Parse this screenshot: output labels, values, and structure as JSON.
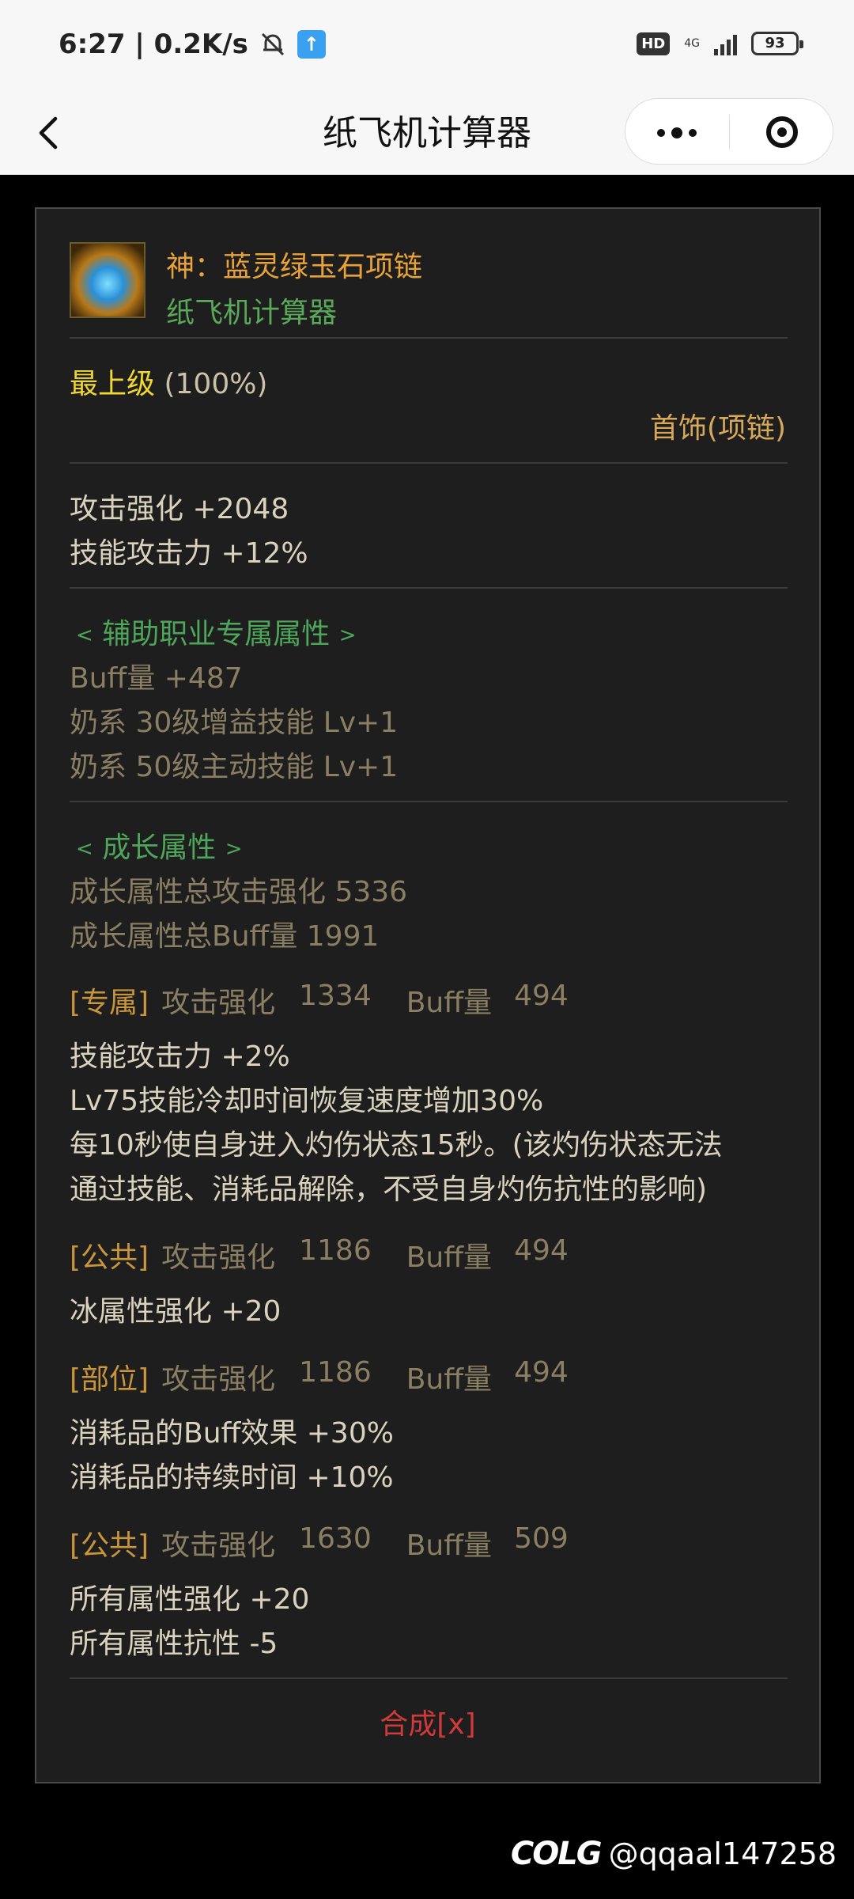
{
  "status_bar": {
    "time_speed": "6:27 | 0.2K/s",
    "hd_badge": "HD",
    "network": "4G",
    "battery": "93"
  },
  "title_bar": {
    "title": "纸飞机计算器"
  },
  "item": {
    "name": "神：蓝灵绿玉石项链",
    "subtitle": "纸飞机计算器",
    "grade_label": "最上级",
    "grade_value": " (100%)",
    "slot_type": "首饰(项链)",
    "base_stats": [
      "攻击强化 +2048",
      "技能攻击力 +12%"
    ],
    "support_header": "辅助职业专属属性",
    "support_stats": [
      "Buff量 +487",
      "奶系 30级增益技能 Lv+1",
      "奶系 50级主动技能 Lv+1"
    ],
    "growth_header": "成长属性",
    "growth_totals": [
      "成长属性总攻击强化 5336",
      "成长属性总Buff量 1991"
    ],
    "growth_lines": [
      {
        "tag": "[专属]",
        "atk_label": "攻击强化",
        "atk": "1334",
        "buff_label": "Buff量",
        "buff": "494",
        "effects": [
          "技能攻击力 +2%",
          "Lv75技能冷却时间恢复速度增加30%",
          "每10秒使自身进入灼伤状态15秒。(该灼伤状态无法",
          "通过技能、消耗品解除，不受自身灼伤抗性的影响)"
        ]
      },
      {
        "tag": "[公共]",
        "atk_label": "攻击强化",
        "atk": "1186",
        "buff_label": "Buff量",
        "buff": "494",
        "effects": [
          "冰属性强化 +20"
        ]
      },
      {
        "tag": "[部位]",
        "atk_label": "攻击强化",
        "atk": "1186",
        "buff_label": "Buff量",
        "buff": "494",
        "effects": [
          "消耗品的Buff效果 +30%",
          "消耗品的持续时间 +10%"
        ]
      },
      {
        "tag": "[公共]",
        "atk_label": "攻击强化",
        "atk": "1630",
        "buff_label": "Buff量",
        "buff": "509",
        "effects": [
          "所有属性强化 +20",
          "所有属性抗性 -5"
        ]
      }
    ],
    "synth_link": "合成[x]"
  },
  "watermark": {
    "logo": "COLG",
    "text": "@qqaal147258"
  }
}
